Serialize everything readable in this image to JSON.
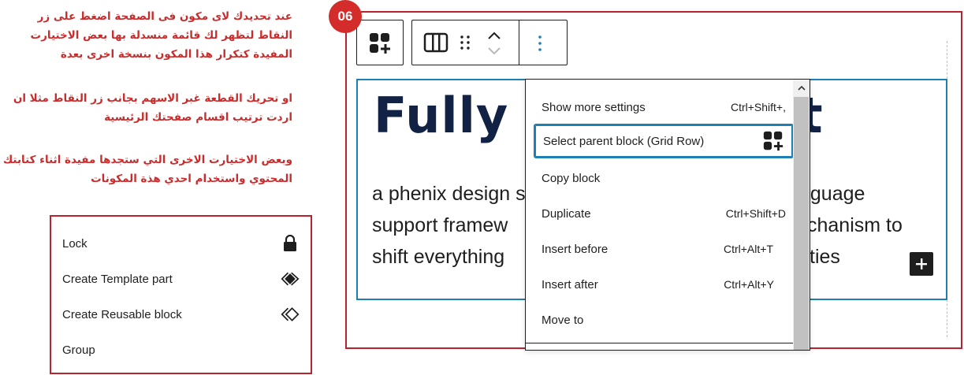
{
  "instructions": {
    "paragraph1": "عند تحديدك لاى مكون فى الصفحة اضغط على زر النقاط لتظهر لك قائمة منسدلة بها بعض الاختيارت المفيدة كتكرار هذا المكون بنسخة اخرى بعدة",
    "paragraph2": "او تحريك القطعة غبر الاسهم بجانب زر النقاط مثلا ان اردت ترتيب اقسام صفحتك الرئيسية",
    "paragraph3": "وبعض الاختيارت الاخرى التي ستجدها مفيدة اثناء كتابتك المحتوي واستخدام احدي هذة المكونات"
  },
  "badge": "06",
  "options_box": {
    "items": [
      {
        "label": "Lock",
        "icon": "lock-icon"
      },
      {
        "label": "Create Template part",
        "icon": "template-part-icon"
      },
      {
        "label": "Create Reusable block",
        "icon": "reusable-block-icon"
      },
      {
        "label": "Group",
        "icon": ""
      }
    ]
  },
  "toolbar": {
    "parent_icon": "grid-add-icon",
    "block_icon": "columns-icon",
    "drag_icon": "drag-handle-icon",
    "move_up_icon": "chevron-up-icon",
    "move_down_icon": "chevron-down-icon",
    "options_icon": "more-vertical-icon"
  },
  "block": {
    "heading_visible": "Fully R",
    "heading_tail": "t",
    "para_lines_left": [
      "a phenix design s",
      "support framew",
      "shift everything"
    ],
    "para_lines_right": [
      "nguage",
      "chanism to",
      "ties"
    ]
  },
  "dropdown": {
    "items": [
      {
        "label": "Show more settings",
        "shortcut": "Ctrl+Shift+,"
      },
      {
        "label": "Select parent block (Grid Row)",
        "shortcut": "",
        "selected": true
      },
      {
        "label": "Copy block",
        "shortcut": ""
      },
      {
        "label": "Duplicate",
        "shortcut": "Ctrl+Shift+D"
      },
      {
        "label": "Insert before",
        "shortcut": "Ctrl+Alt+T"
      },
      {
        "label": "Insert after",
        "shortcut": "Ctrl+Alt+Y"
      },
      {
        "label": "Move to",
        "shortcut": ""
      }
    ]
  },
  "colors": {
    "accent_red": "#cc2b2b",
    "frame_red": "#b8232f",
    "wp_blue": "#1e7fb3",
    "heading_navy": "#112244"
  }
}
